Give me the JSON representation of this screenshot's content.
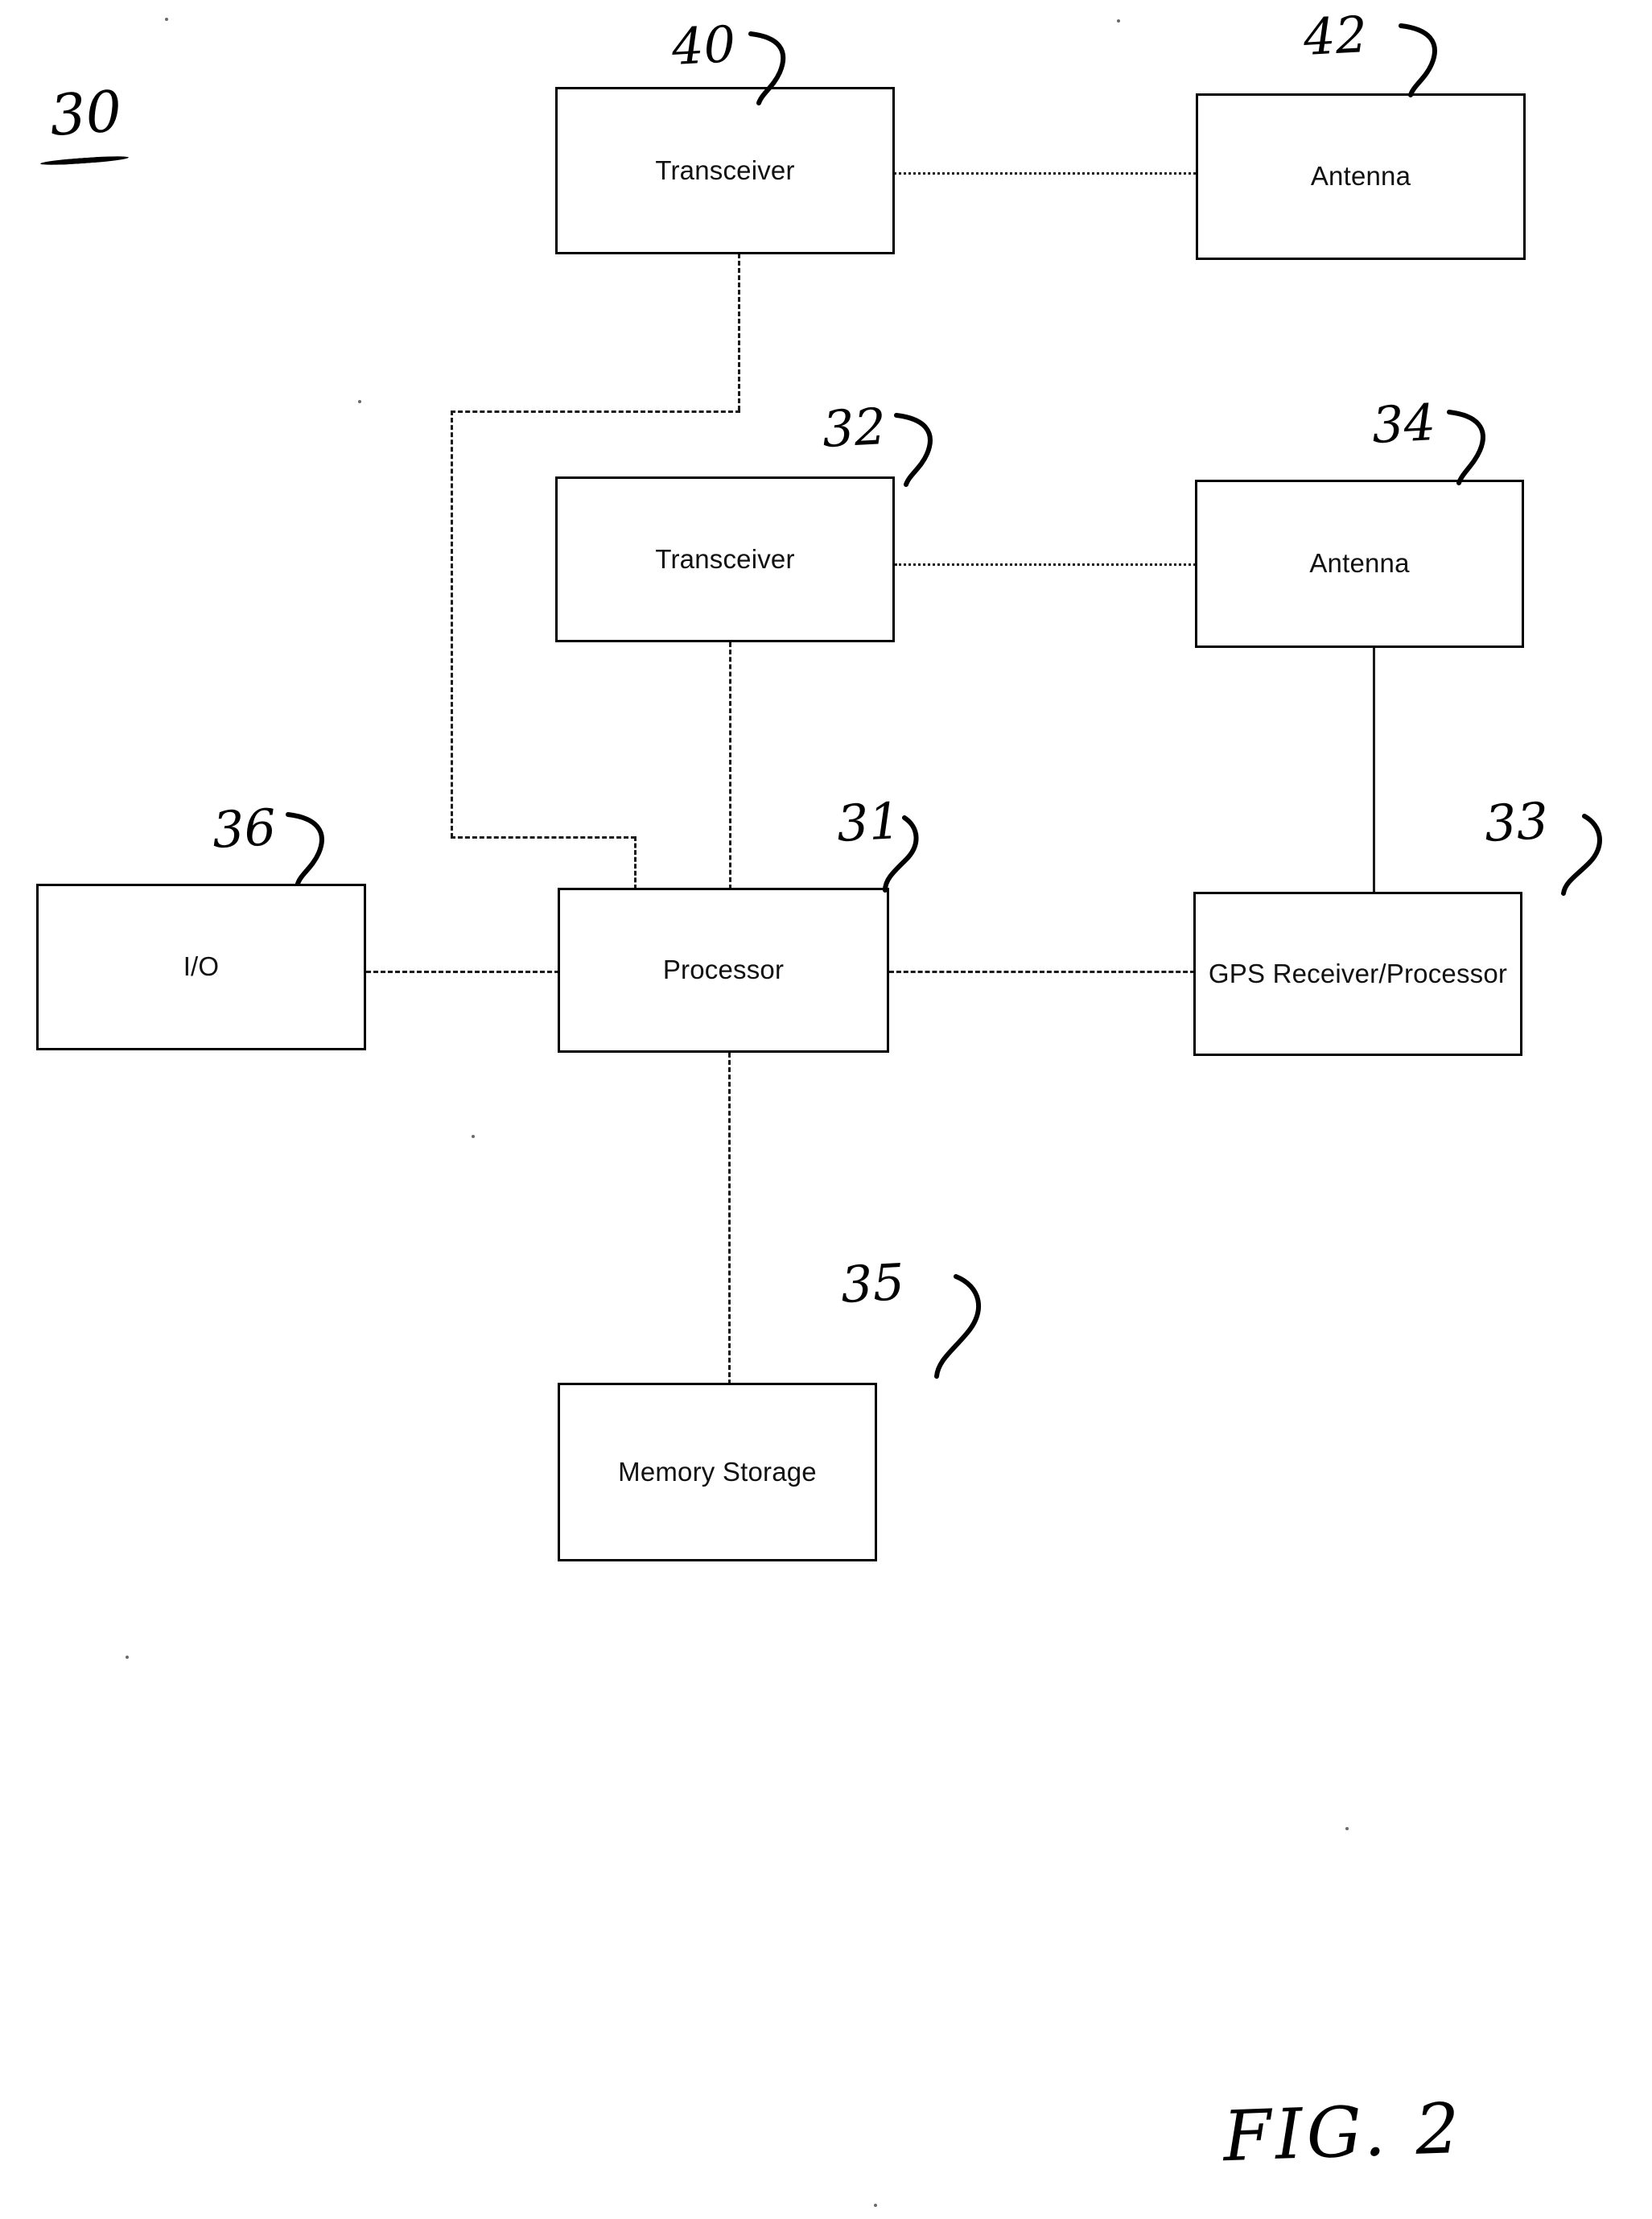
{
  "figure": {
    "caption": "FIG. 2",
    "system_numeral": "30"
  },
  "blocks": [
    {
      "id": "transceiver_40",
      "label": "Transceiver",
      "numeral": "40"
    },
    {
      "id": "antenna_42",
      "label": "Antenna",
      "numeral": "42"
    },
    {
      "id": "transceiver_32",
      "label": "Transceiver",
      "numeral": "32"
    },
    {
      "id": "antenna_34",
      "label": "Antenna",
      "numeral": "34"
    },
    {
      "id": "io_36",
      "label": "I/O",
      "numeral": "36"
    },
    {
      "id": "processor_31",
      "label": "Processor",
      "numeral": "31"
    },
    {
      "id": "gps_33",
      "label": "GPS Receiver/Processor",
      "numeral": "33"
    },
    {
      "id": "memory_35",
      "label": "Memory Storage",
      "numeral": "35"
    }
  ],
  "connections": [
    {
      "from": "transceiver_40",
      "to": "antenna_42",
      "style": "dotted"
    },
    {
      "from": "transceiver_32",
      "to": "antenna_34",
      "style": "dotted"
    },
    {
      "from": "transceiver_40",
      "to": "processor_31",
      "style": "dash-dot"
    },
    {
      "from": "transceiver_32",
      "to": "processor_31",
      "style": "dash-dot"
    },
    {
      "from": "io_36",
      "to": "processor_31",
      "style": "dash-dot"
    },
    {
      "from": "processor_31",
      "to": "gps_33",
      "style": "dash-dot"
    },
    {
      "from": "antenna_34",
      "to": "gps_33",
      "style": "solid"
    },
    {
      "from": "processor_31",
      "to": "memory_35",
      "style": "dash-dot"
    }
  ],
  "colors": {
    "ink": "#000000",
    "paper": "#ffffff"
  }
}
